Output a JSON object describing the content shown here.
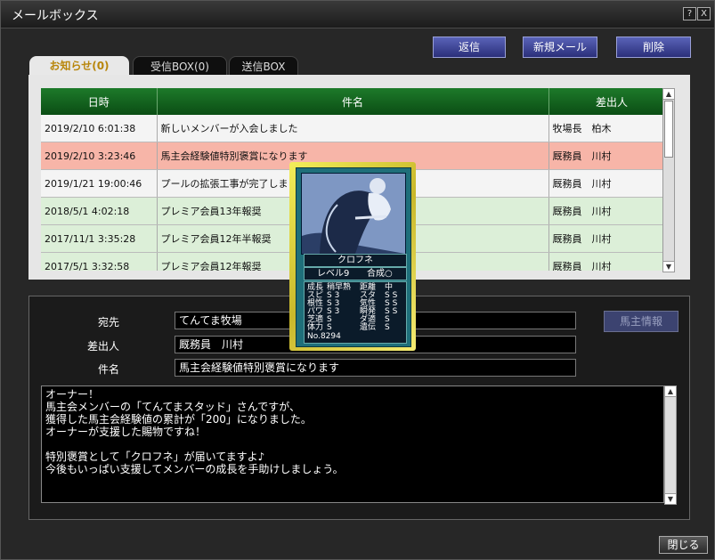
{
  "window": {
    "title": "メールボックス",
    "help_label": "?",
    "close_label": "X"
  },
  "toolbar": {
    "reply_label": "返信",
    "new_label": "新規メール",
    "delete_label": "削除"
  },
  "tabs": [
    {
      "label": "お知らせ(0)"
    },
    {
      "label": "受信BOX(0)"
    },
    {
      "label": "送信BOX"
    }
  ],
  "table": {
    "columns": [
      "日時",
      "件名",
      "差出人"
    ],
    "rows": [
      {
        "date": "2019/2/10 6:01:38",
        "subject": "新しいメンバーが入会しました",
        "sender": "牧場長　柏木"
      },
      {
        "date": "2019/2/10 3:23:46",
        "subject": "馬主会経験値特別褒賞になります",
        "sender": "厩務員　川村"
      },
      {
        "date": "2019/1/21 19:00:46",
        "subject": "プールの拡張工事が完了しま",
        "sender": "厩務員　川村"
      },
      {
        "date": "2018/5/1 4:02:18",
        "subject": "プレミア会員13年報奨",
        "sender": "厩務員　川村"
      },
      {
        "date": "2017/11/1 3:35:28",
        "subject": "プレミア会員12年半報奨",
        "sender": "厩務員　川村"
      },
      {
        "date": "2017/5/1 3:32:58",
        "subject": "プレミア会員12年報奨",
        "sender": "厩務員　川村"
      }
    ]
  },
  "detail": {
    "to_label": "宛先",
    "to_value": "てんてま牧場",
    "from_label": "差出人",
    "from_value": "厩務員　川村",
    "subject_label": "件名",
    "subject_value": "馬主会経験値特別褒賞になります",
    "owner_info_label": "馬主情報",
    "body": "オーナー！\n馬主会メンバーの「てんてまスタッド」さんですが、\n獲得した馬主会経験値の累計が「200」になりました。\nオーナーが支援した賜物ですね！\n\n特別褒賞として「クロフネ」が届いてますよ♪\n今後もいっぱい支援してメンバーの成長を手助けしましょう。"
  },
  "card": {
    "name": "クロフネ",
    "level": "レベル9",
    "fusion": "合成○",
    "stats": [
      [
        "成長",
        "稍早熟",
        "距離",
        "中"
      ],
      [
        "スピ",
        "S 3",
        "スタ",
        "S S"
      ],
      [
        "根性",
        "S 3",
        "気性",
        "S S"
      ],
      [
        "パワ",
        "S 3",
        "瞬発",
        "S S"
      ],
      [
        "芝適",
        "S",
        "ダ適",
        "S"
      ],
      [
        "体力",
        "S",
        "遺伝",
        "S"
      ]
    ],
    "number": "No.8294"
  },
  "footer": {
    "close_label": "閉じる"
  },
  "colors": {
    "header_green": "#1d7a2a",
    "selected_row": "#f7b5a8",
    "card_gold": "#f3ee5a",
    "button_blue": "#3d45a0"
  }
}
